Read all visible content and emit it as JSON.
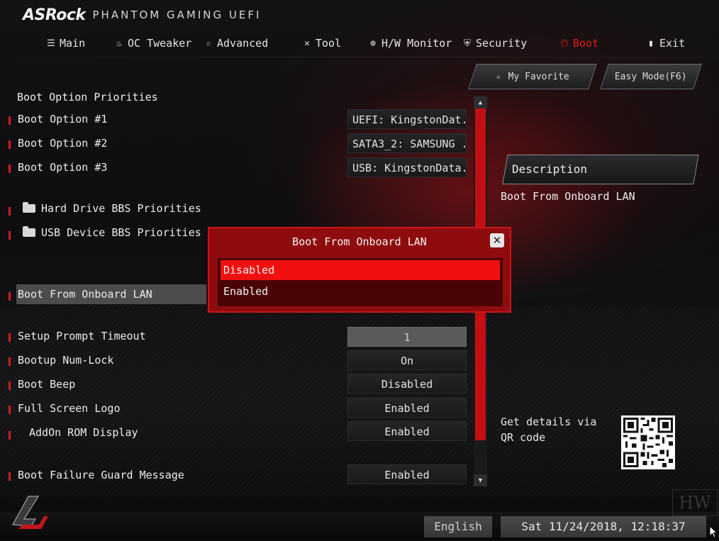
{
  "brand": {
    "name": "ASRock",
    "subtitle": "PHANTOM GAMING UEFI"
  },
  "nav": [
    {
      "label": "Main",
      "icon": "list-icon"
    },
    {
      "label": "OC Tweaker",
      "icon": "flame-icon"
    },
    {
      "label": "Advanced",
      "icon": "star-icon"
    },
    {
      "label": "Tool",
      "icon": "tools-icon"
    },
    {
      "label": "H/W Monitor",
      "icon": "monitor-icon"
    },
    {
      "label": "Security",
      "icon": "shield-icon"
    },
    {
      "label": "Boot",
      "icon": "power-icon",
      "active": true
    },
    {
      "label": "Exit",
      "icon": "exit-door-icon"
    }
  ],
  "quick": {
    "favorite": "My Favorite",
    "easy_mode": "Easy Mode(F6)"
  },
  "section_title": "Boot Option Priorities",
  "rows": [
    {
      "label": "Boot Option #1",
      "value": "UEFI: KingstonDat..."
    },
    {
      "label": "Boot Option #2",
      "value": "SATA3_2: SAMSUNG ..."
    },
    {
      "label": "Boot Option #3",
      "value": "USB: KingstonData..."
    },
    {
      "label": "Hard Drive BBS Priorities"
    },
    {
      "label": "USB Device BBS Priorities"
    },
    {
      "label": "Boot From Onboard LAN"
    },
    {
      "label": "Setup Prompt Timeout",
      "value": "1"
    },
    {
      "label": "Bootup Num-Lock",
      "value": "On"
    },
    {
      "label": "Boot Beep",
      "value": "Disabled"
    },
    {
      "label": "Full Screen Logo",
      "value": "Enabled"
    },
    {
      "label": "AddOn ROM Display",
      "value": "Enabled"
    },
    {
      "label": "Boot Failure Guard Message",
      "value": "Enabled"
    }
  ],
  "description": {
    "title": "Description",
    "text": "Boot From Onboard LAN",
    "qr_text": "Get details via QR code"
  },
  "modal": {
    "title": "Boot From Onboard LAN",
    "options": [
      "Disabled",
      "Enabled"
    ],
    "selected_index": 0
  },
  "footer": {
    "language": "English",
    "datetime": "Sat 11/24/2018, 12:18:37",
    "watermark": "HW"
  },
  "colors": {
    "accent": "#e31d1d",
    "modal_bg": "#8e0c0e",
    "selected_option": "#f01010"
  }
}
